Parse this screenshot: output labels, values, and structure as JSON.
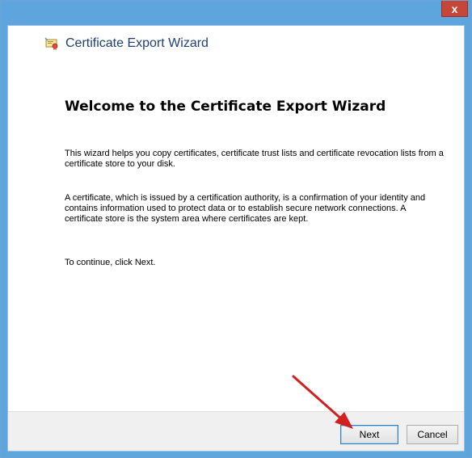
{
  "window": {
    "close_glyph": "x"
  },
  "wizard": {
    "title": "Certificate Export Wizard",
    "icon": "certificate-icon",
    "heading": "Welcome to the Certificate Export Wizard",
    "paragraphs": [
      "This wizard helps you copy certificates, certificate trust lists and certificate revocation lists from a certificate store to your disk.",
      "A certificate, which is issued by a certification authority, is a confirmation of your identity and contains information used to protect data or to establish secure network connections. A certificate store is the system area where certificates are kept.",
      "To continue, click Next."
    ]
  },
  "buttons": {
    "next_label": "Next",
    "cancel_label": "Cancel"
  },
  "colors": {
    "frame": "#5fa5dd",
    "close": "#c7463a",
    "title_text": "#1f3f75",
    "annotation_arrow": "#d21f1f"
  },
  "annotation": {
    "icon": "red-arrow-icon"
  }
}
